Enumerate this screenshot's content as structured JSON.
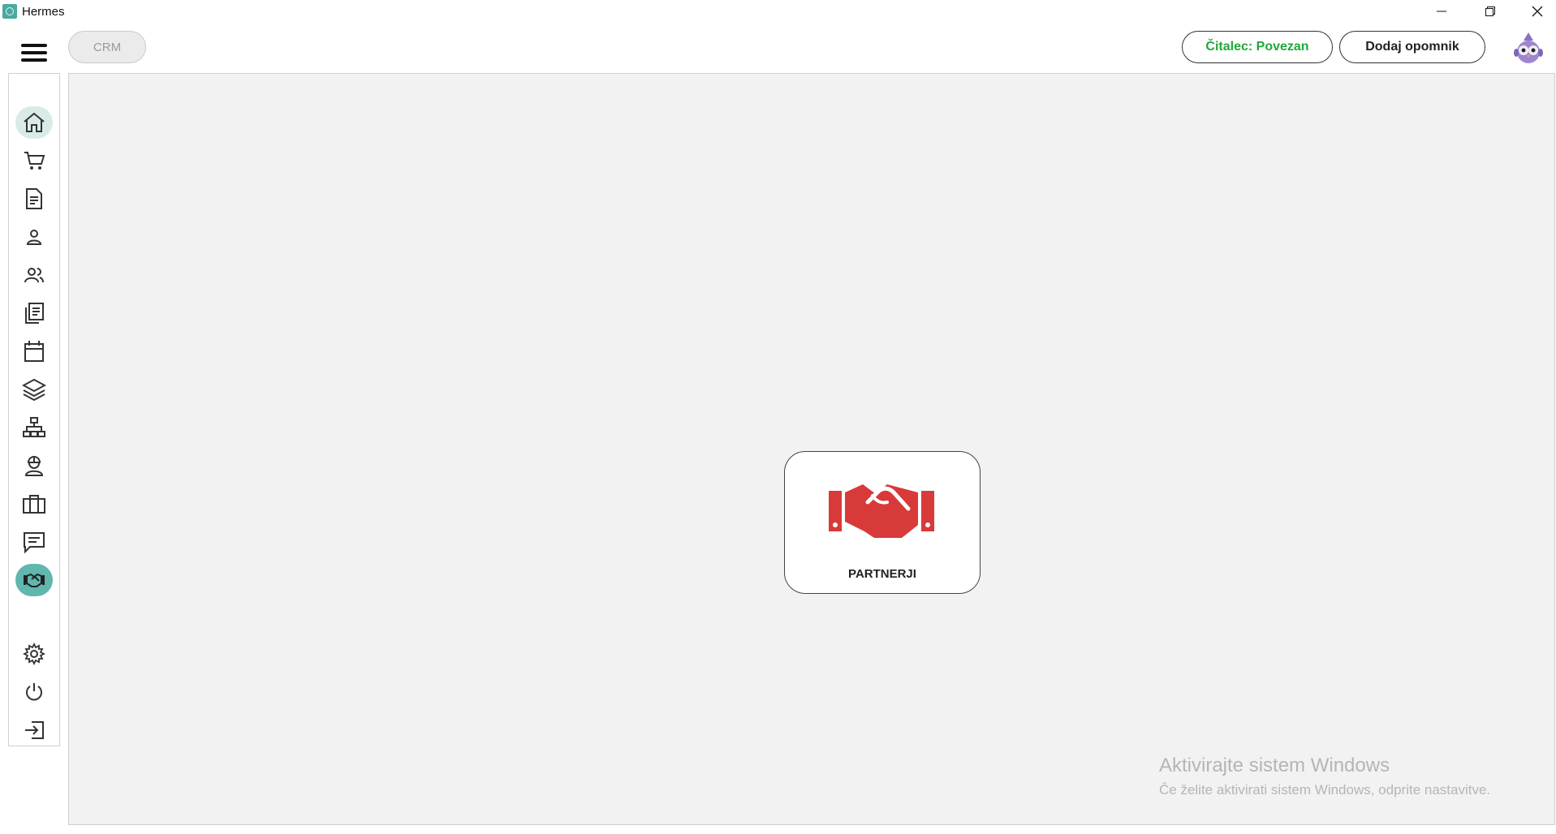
{
  "window": {
    "title": "Hermes",
    "controls": [
      "minimize-icon",
      "restore-icon",
      "close-icon"
    ]
  },
  "topbar": {
    "module_label": "CRM",
    "reader_status": "Čitalec: Povezan",
    "reader_status_color": "#21a83a",
    "add_reminder_label": "Dodaj opomnik",
    "avatar": "owl-avatar"
  },
  "sidebar": {
    "items": [
      {
        "icon": "home-icon",
        "active": true
      },
      {
        "icon": "cart-icon"
      },
      {
        "icon": "document-icon"
      },
      {
        "icon": "person-icon"
      },
      {
        "icon": "people-icon"
      },
      {
        "icon": "documents-icon"
      },
      {
        "icon": "calendar-icon"
      },
      {
        "icon": "layers-icon"
      },
      {
        "icon": "hierarchy-icon"
      },
      {
        "icon": "worker-icon"
      },
      {
        "icon": "briefcase-icon"
      },
      {
        "icon": "message-icon"
      },
      {
        "icon": "handshake-icon",
        "active": true
      },
      {
        "icon": "settings-icon"
      },
      {
        "icon": "power-icon"
      },
      {
        "icon": "logout-icon"
      }
    ],
    "accent_color": "#5fb7ad"
  },
  "main": {
    "tiles": [
      {
        "label": "PARTNERJI",
        "icon": "handshake-icon",
        "icon_color": "#d83a3a"
      }
    ]
  },
  "watermark": {
    "title": "Aktivirajte sistem Windows",
    "subtitle": "Če želite aktivirati sistem Windows, odprite nastavitve."
  }
}
